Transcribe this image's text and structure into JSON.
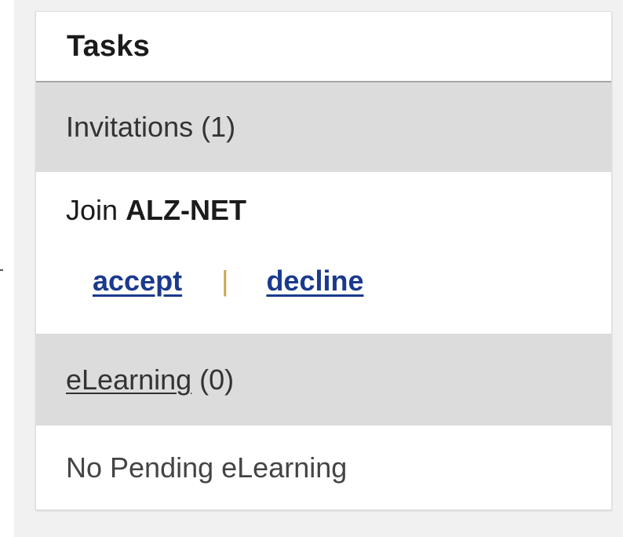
{
  "tasks_panel": {
    "title": "Tasks",
    "invitations": {
      "label": "Invitations",
      "count": "(1)",
      "items": [
        {
          "prefix": "Join",
          "name": "ALZ-NET",
          "accept_label": "accept",
          "separator": "|",
          "decline_label": "decline"
        }
      ]
    },
    "elearning": {
      "label": "eLearning",
      "count": "(0)",
      "empty_text": "No Pending eLearning"
    }
  }
}
